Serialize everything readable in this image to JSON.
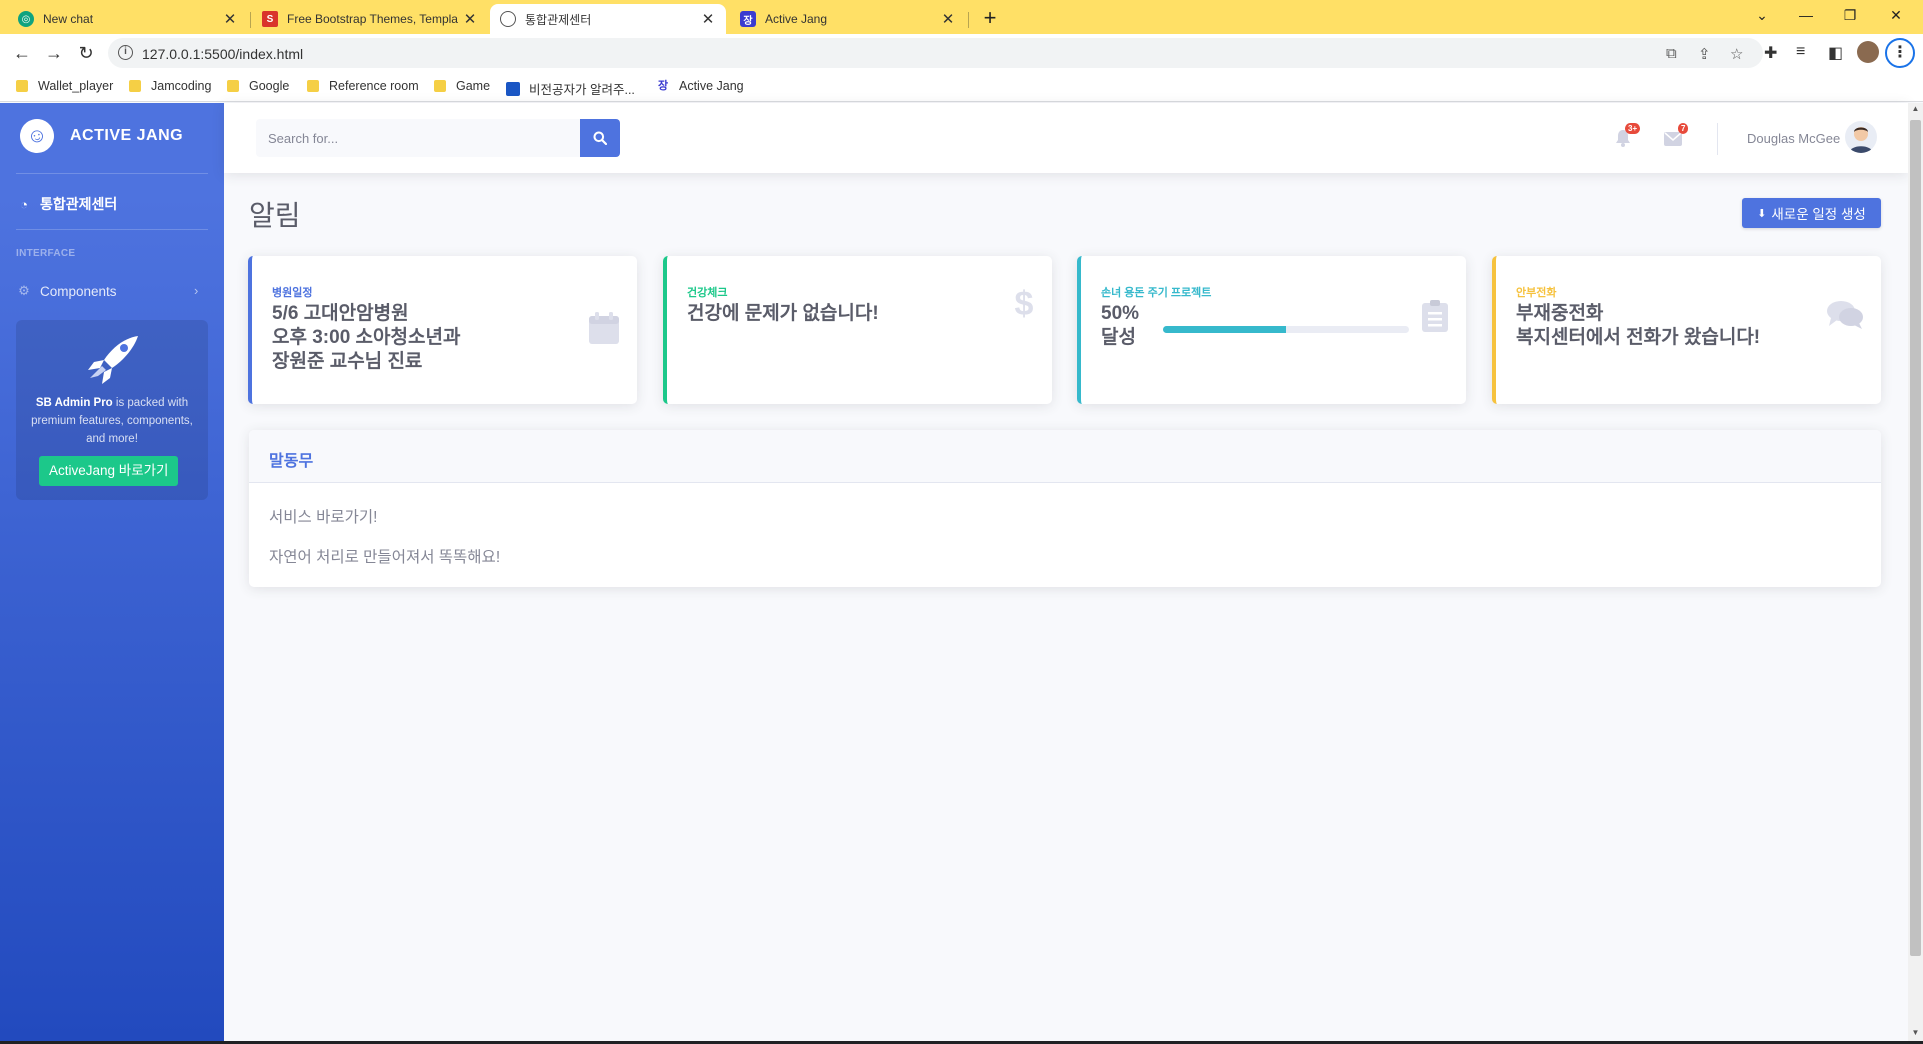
{
  "browser": {
    "tabs": [
      {
        "title": "New chat",
        "favicon": "chatgpt-icon"
      },
      {
        "title": "Free Bootstrap Themes, Templa",
        "favicon": "s-icon"
      },
      {
        "title": "통합관제센터",
        "favicon": "globe-icon"
      },
      {
        "title": "Active Jang",
        "favicon": "active-jang-icon"
      }
    ],
    "url": "127.0.0.1:5500/index.html",
    "bookmarks": [
      {
        "label": "Wallet_player",
        "icon": "folder-icon"
      },
      {
        "label": "Jamcoding",
        "icon": "folder-icon"
      },
      {
        "label": "Google",
        "icon": "folder-icon"
      },
      {
        "label": "Reference room",
        "icon": "folder-icon"
      },
      {
        "label": "Game",
        "icon": "folder-icon"
      },
      {
        "label": "비전공자가 알려주...",
        "icon": "book-icon"
      },
      {
        "label": "Active Jang",
        "icon": "active-jang-icon"
      }
    ]
  },
  "sidebar": {
    "brand": "ACTIVE JANG",
    "dashboard_label": "통합관제센터",
    "heading": "INTERFACE",
    "components_label": "Components",
    "promo": {
      "bold": "SB Admin Pro",
      "text": " is packed with premium features, components, and more!",
      "button": "ActiveJang 바로가기"
    }
  },
  "topbar": {
    "search_placeholder": "Search for...",
    "alerts_badge": "3+",
    "messages_badge": "7",
    "username": "Douglas McGee"
  },
  "page": {
    "title": "알림",
    "new_button": "새로운 일정 생성"
  },
  "cards": [
    {
      "label": "병원일정",
      "lines": [
        "5/6 고대안암병원",
        "오후 3:00 소아청소년과",
        "장원준 교수님 진료"
      ],
      "color": "#4e73df",
      "icon": "calendar-icon"
    },
    {
      "label": "건강체크",
      "lines": [
        "건강에 문제가 없습니다!"
      ],
      "color": "#1cc88a",
      "icon": "dollar-icon"
    },
    {
      "label": "손녀 용돈 주기 프로젝트",
      "value": "50%",
      "value2": "달성",
      "progress": 0.5,
      "color": "#36b9cc",
      "icon": "clipboard-icon"
    },
    {
      "label": "안부전화",
      "lines": [
        "부재중전화",
        "복지센터에서 전화가 왔습니다!"
      ],
      "color": "#f6c23e",
      "icon": "comments-icon"
    }
  ],
  "panel": {
    "title": "말동무",
    "lines": [
      "서비스 바로가기!",
      "자연어 처리로 만들어져서 똑똑해요!"
    ]
  }
}
